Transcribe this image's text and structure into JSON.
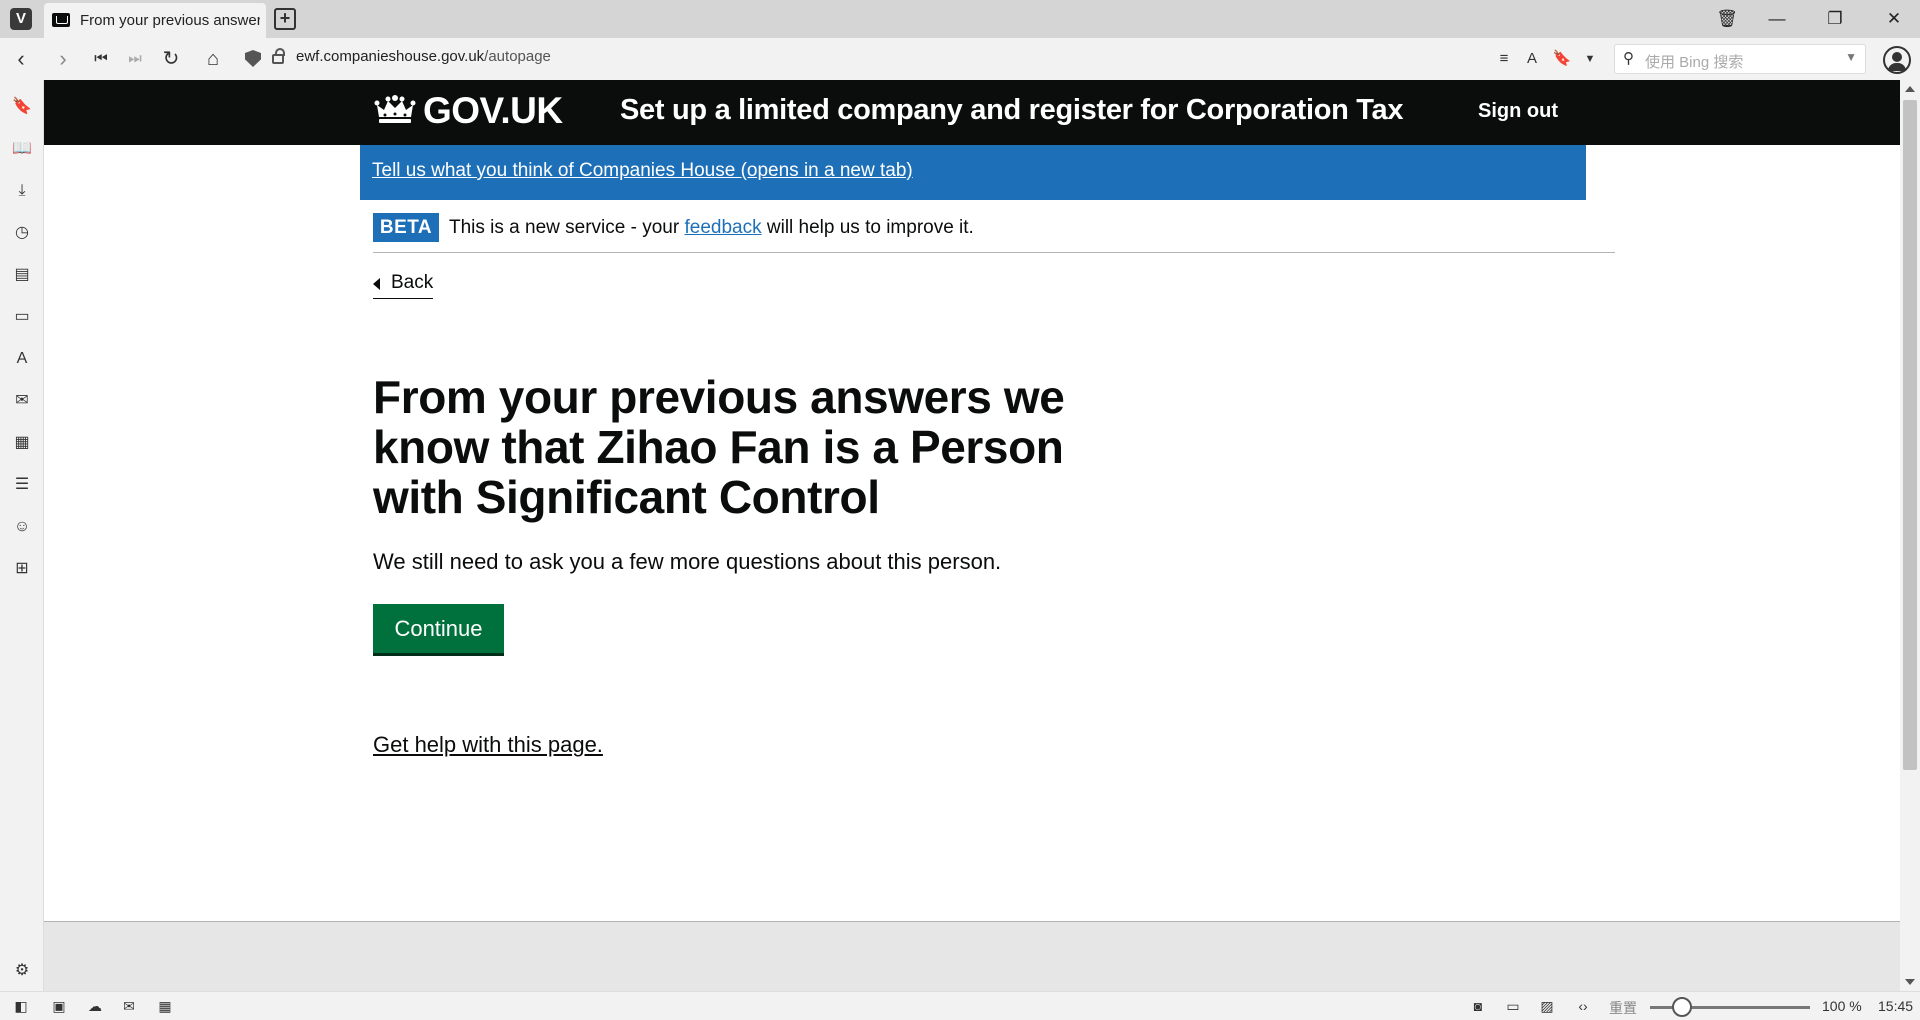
{
  "browser": {
    "tab_title": "From your previous answer",
    "url_domain": "ewf.companieshouse.gov.uk",
    "url_path": "/autopage",
    "search_placeholder": "使用 Bing 搜索",
    "zoom_label": "重置",
    "zoom_percent": "100 %",
    "clock": "15:45"
  },
  "site": {
    "logo_text": "GOV.UK",
    "service_name": "Set up a limited company and register for Corporation Tax",
    "sign_out": "Sign out",
    "feedback_link": "Tell us what you think of Companies House (opens in a new tab)",
    "beta_tag": "BETA",
    "beta_text_before": "This is a new service - your ",
    "beta_link": "feedback",
    "beta_text_after": " will help us to improve it."
  },
  "main": {
    "back_label": "Back",
    "heading": "From your previous answers we know that Zihao Fan is a Person with Significant Control",
    "body": "We still need to ask you a few more questions about this person.",
    "continue_label": "Continue",
    "help_link": "Get help with this page."
  },
  "colors": {
    "header_bg": "#0b0c0c",
    "feedback_bar": "#1d70b8",
    "button_green": "#00703c",
    "link_blue": "#1d70b8"
  }
}
